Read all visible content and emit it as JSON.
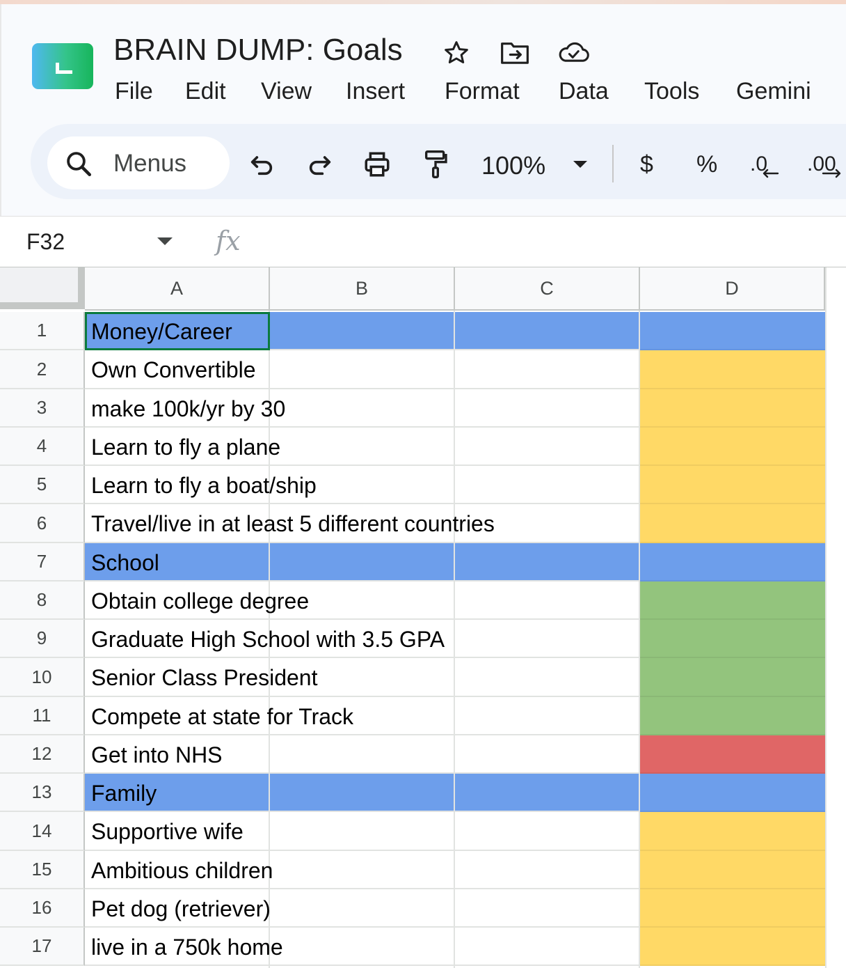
{
  "app": {
    "title": "BRAIN DUMP: Goals",
    "menus": [
      "File",
      "Edit",
      "View",
      "Insert",
      "Format",
      "Data",
      "Tools",
      "Gemini"
    ]
  },
  "toolbar": {
    "search_label": "Menus",
    "zoom": "100%",
    "currency": "$",
    "percent": "%",
    "decrease_decimal": ".0",
    "increase_decimal": ".00"
  },
  "formula_bar": {
    "name_box": "F32",
    "fx_label": "fx",
    "formula": ""
  },
  "sheet": {
    "columns": [
      "A",
      "B",
      "C",
      "D"
    ],
    "active_cell": "A1",
    "rows": [
      {
        "num": "1",
        "text": "Money/Career",
        "band": "#6d9eeb",
        "status": "#6d9eeb"
      },
      {
        "num": "2",
        "text": "Own Convertible",
        "band": "",
        "status": "#ffd966"
      },
      {
        "num": "3",
        "text": "make 100k/yr by 30",
        "band": "",
        "status": "#ffd966"
      },
      {
        "num": "4",
        "text": "Learn to fly a plane",
        "band": "",
        "status": "#ffd966"
      },
      {
        "num": "5",
        "text": "Learn to fly a boat/ship",
        "band": "",
        "status": "#ffd966"
      },
      {
        "num": "6",
        "text": "Travel/live in at least 5 different countries",
        "band": "",
        "status": "#ffd966"
      },
      {
        "num": "7",
        "text": "School",
        "band": "#6d9eeb",
        "status": "#6d9eeb"
      },
      {
        "num": "8",
        "text": "Obtain college degree",
        "band": "",
        "status": "#93c47d"
      },
      {
        "num": "9",
        "text": "Graduate High School with 3.5 GPA",
        "band": "",
        "status": "#93c47d"
      },
      {
        "num": "10",
        "text": "Senior Class President",
        "band": "",
        "status": "#93c47d"
      },
      {
        "num": "11",
        "text": "Compete at state for Track",
        "band": "",
        "status": "#93c47d"
      },
      {
        "num": "12",
        "text": "Get into NHS",
        "band": "",
        "status": "#e06666"
      },
      {
        "num": "13",
        "text": "Family",
        "band": "#6d9eeb",
        "status": "#6d9eeb"
      },
      {
        "num": "14",
        "text": "Supportive wife",
        "band": "",
        "status": "#ffd966"
      },
      {
        "num": "15",
        "text": "Ambitious children",
        "band": "",
        "status": "#ffd966"
      },
      {
        "num": "16",
        "text": "Pet dog (retriever)",
        "band": "",
        "status": "#ffd966"
      },
      {
        "num": "17",
        "text": "live in a 750k home",
        "band": "",
        "status": "#ffd966"
      }
    ]
  },
  "colors": {
    "header_blue": "#6d9eeb",
    "in_progress_yellow": "#ffd966",
    "done_green": "#93c47d",
    "not_done_red": "#e06666",
    "selection_green": "#0b7a3e"
  },
  "icons": {
    "logo": "sheets-logo",
    "star": "star-icon",
    "move": "move-to-folder-icon",
    "cloud": "cloud-saved-icon",
    "search": "search-icon",
    "undo": "undo-icon",
    "redo": "redo-icon",
    "print": "print-icon",
    "paint": "paint-format-icon",
    "zoom_dropdown": "caret-down-icon"
  }
}
